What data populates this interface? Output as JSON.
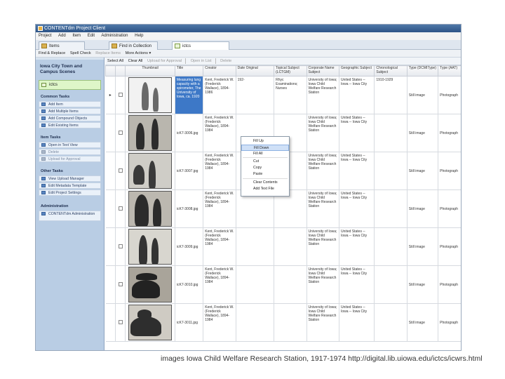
{
  "window": {
    "title": "CONTENTdm Project Client"
  },
  "menu": [
    "Project",
    "Add",
    "Item",
    "Edit",
    "Administration",
    "Help"
  ],
  "tabs": [
    {
      "label": "Items"
    },
    {
      "label": "Find in Collection"
    },
    {
      "label": "ictcs"
    }
  ],
  "toolbar": {
    "find_replace": "Find & Replace",
    "spell_check": "Spell Check",
    "replace_items": "Replace Items",
    "more_actions": "More Actions ▾"
  },
  "grid_toolbar": {
    "select_all": "Select All",
    "clear_all": "Clear All",
    "upload": "Upload for Approval",
    "open_list": "Open in List",
    "delete": "Delete"
  },
  "left": {
    "project_title": "Iowa City Town and Campus Scenes",
    "collection": "ictcs",
    "sections": [
      {
        "label": "Common Tasks",
        "items": [
          {
            "label": "Add Item"
          },
          {
            "label": "Add Multiple Items"
          },
          {
            "label": "Add Compound Objects"
          },
          {
            "label": "Edit Existing Items"
          }
        ]
      },
      {
        "label": "Item Tasks",
        "items": [
          {
            "label": "Open in Text View"
          },
          {
            "label": "Delete"
          },
          {
            "label": "Upload for Approval"
          }
        ]
      },
      {
        "label": "Other Tasks",
        "items": [
          {
            "label": "View Upload Manager"
          },
          {
            "label": "Edit Metadata Template"
          },
          {
            "label": "Edit Project Settings"
          }
        ]
      },
      {
        "label": "Administration",
        "items": [
          {
            "label": "CONTENTdm Administration"
          }
        ]
      }
    ]
  },
  "columns": [
    "",
    "",
    "Thumbnail",
    "Title",
    "Creator",
    "Date Original",
    "Topical Subject (LCTGM)",
    "Corporate Name Subject",
    "Geographic Subject",
    "Chronological Subject",
    "Type (DCMIType)",
    "Type (AAT)"
  ],
  "rows": [
    {
      "title": "Measuring lung capacity with a spirometer, The University of Iowa, ca. 1920",
      "creator": "Kent, Frederick W. (Frederick Wallace), 1894-1986",
      "date": "192-",
      "topical": "Rhyc Examinations; Nurses",
      "corp": "University of Iowa; Iowa Child Welfare Research Station",
      "geo": "United States -- Iowa -- Iowa City",
      "chrono": "1910-1929",
      "type": "Still image",
      "aat": "Photograph"
    },
    {
      "title": "icK7-3006.jpg",
      "creator": "Kent, Frederick W. (Frederick Wallace), 1894-1984",
      "date": "",
      "topical": "",
      "corp": "University of Iowa; Iowa Child Welfare Research Station",
      "geo": "United States -- Iowa -- Iowa City",
      "chrono": "",
      "type": "Still image",
      "aat": "Photograph"
    },
    {
      "title": "icK7-3007.jpg",
      "creator": "Kent, Frederick W. (Frederick Wallace), 1894-1984",
      "date": "",
      "topical": "",
      "corp": "University of Iowa; Iowa Child Welfare Research Station",
      "geo": "United States -- Iowa -- Iowa City",
      "chrono": "",
      "type": "Still image",
      "aat": "Photograph"
    },
    {
      "title": "icK7-3008.jpg",
      "creator": "Kent, Frederick W. (Frederick Wallace), 1894-1984",
      "date": "",
      "topical": "",
      "corp": "University of Iowa; Iowa Child Welfare Research Station",
      "geo": "United States -- Iowa -- Iowa City",
      "chrono": "",
      "type": "Still image",
      "aat": "Photograph"
    },
    {
      "title": "icK7-3009.jpg",
      "creator": "Kent, Frederick W. (Frederick Wallace), 1894-1984",
      "date": "",
      "topical": "",
      "corp": "University of Iowa; Iowa Child Welfare Research Station",
      "geo": "United States -- Iowa -- Iowa City",
      "chrono": "",
      "type": "Still image",
      "aat": "Photograph"
    },
    {
      "title": "icK7-3010.jpg",
      "creator": "Kent, Frederick W. (Frederick Wallace), 1894-1984",
      "date": "",
      "topical": "",
      "corp": "University of Iowa; Iowa Child Welfare Research Station",
      "geo": "United States -- Iowa -- Iowa City",
      "chrono": "",
      "type": "Still image",
      "aat": "Photograph"
    },
    {
      "title": "icK7-3011.jpg",
      "creator": "Kent, Frederick W. (Frederick Wallace), 1894-1984",
      "date": "",
      "topical": "",
      "corp": "University of Iowa; Iowa Child Welfare Research Station",
      "geo": "United States -- Iowa -- Iowa City",
      "chrono": "",
      "type": "Still image",
      "aat": "Photograph"
    }
  ],
  "context_menu": [
    "Fill Up",
    "Fill Down",
    "Fill All",
    "Cut",
    "Copy",
    "Paste",
    "Clear Contents",
    "Add Text File"
  ],
  "caption": "images  Iowa Child Welfare Research Station, 1917-1974  http://digital.lib.uiowa.edu/ictcs/icwrs.html"
}
